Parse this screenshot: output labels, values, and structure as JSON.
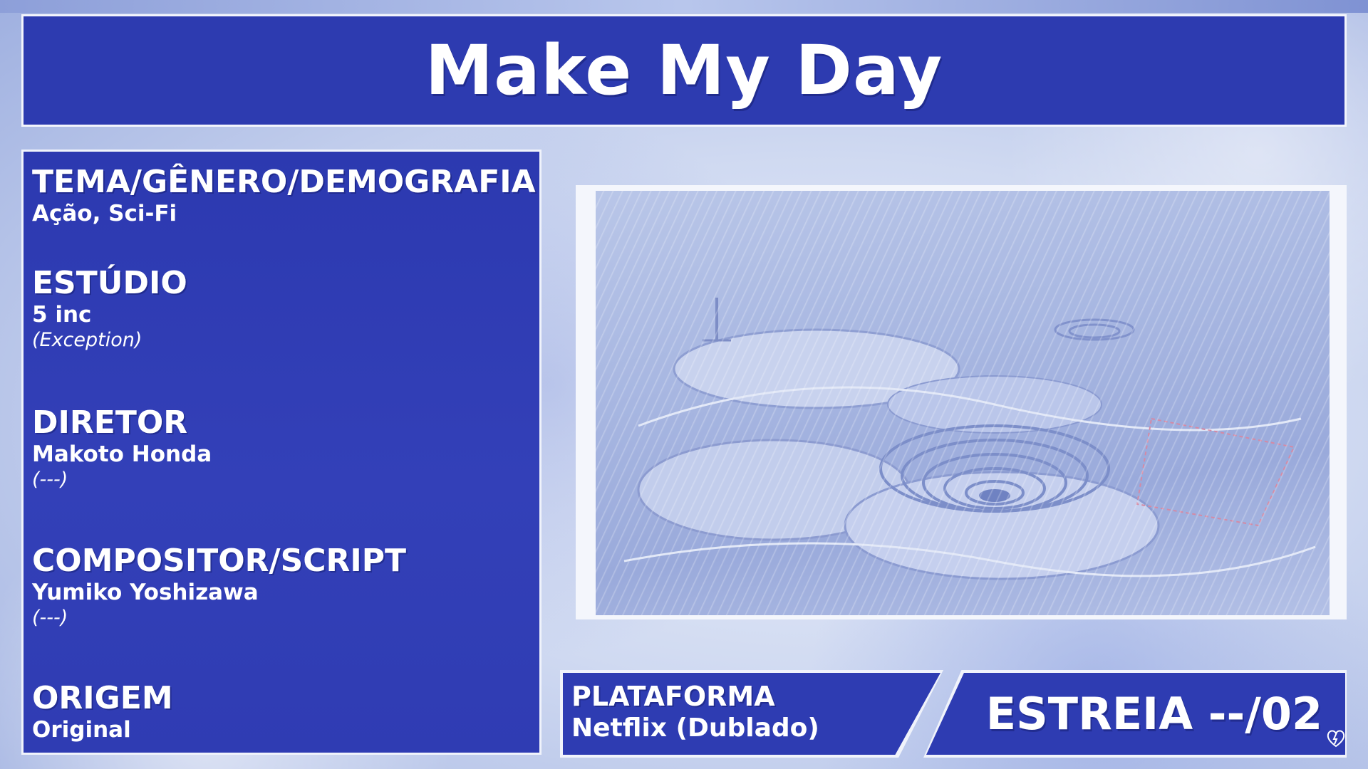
{
  "title": "Make My Day",
  "info": {
    "genre": {
      "label": "TEMA/GÊNERO/DEMOGRAFIA",
      "value": "Ação, Sci-Fi"
    },
    "studio": {
      "label": "ESTÚDIO",
      "value": "5 inc",
      "note": "(Exception)"
    },
    "director": {
      "label": "DIRETOR",
      "value": "Makoto Honda",
      "note": "(---)"
    },
    "composer": {
      "label": "COMPOSITOR/SCRIPT",
      "value": "Yumiko Yoshizawa",
      "note": "(---)"
    },
    "origin": {
      "label": "ORIGEM",
      "value": "Original"
    }
  },
  "platform": {
    "label": "PLATAFORMA",
    "value": "Netflix (Dublado)"
  },
  "premiere": "ESTREIA --/02",
  "colors": {
    "panel": "#2e3cb2",
    "border": "#f0f3fb",
    "text": "#ffffff"
  },
  "icons": {
    "artwork": "snowy-crater-landscape-image",
    "corner": "lightning-heart-icon"
  }
}
